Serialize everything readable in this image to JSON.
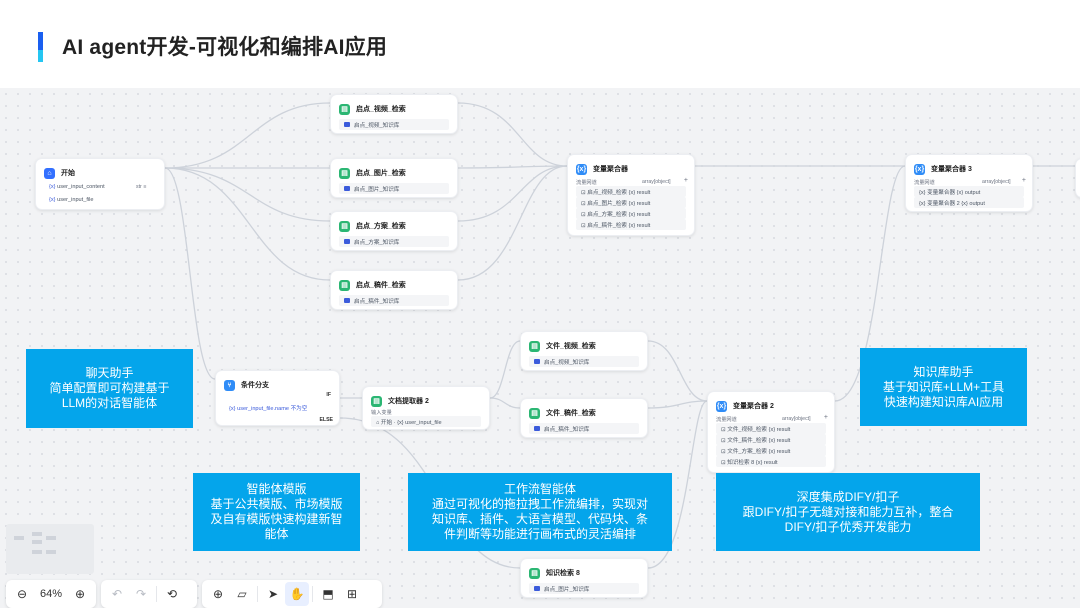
{
  "title": "AI agent开发-可视化和编排AI应用",
  "nodes": {
    "start": {
      "title": "开始",
      "var1": "user_input_content",
      "var1_tag": "str ≡",
      "var2": "user_input_file"
    },
    "video": {
      "title": "启点_视频_检索",
      "row": "启点_视频_知识库"
    },
    "image": {
      "title": "启点_图片_检索",
      "row": "启点_图片_知识库"
    },
    "plan": {
      "title": "启点_方案_检索",
      "row": "启点_方案_知识库"
    },
    "doc": {
      "title": "启点_稿件_检索",
      "row": "启点_稿件_知识库"
    },
    "agg1": {
      "title": "变量聚合器",
      "meta_left": "流量网道",
      "meta_right": "array[object]",
      "rows": [
        "⊡ 启点_视频_检索   {x} result",
        "⊡ 启点_图片_检索   {x} result",
        "⊡ 启点_方案_检索   {x} result",
        "⊡ 启点_稿件_检索   {x} result"
      ]
    },
    "agg3": {
      "title": "变量聚合器 3",
      "meta_left": "流量网道",
      "meta_right": "array[object]",
      "rows": [
        "{x} 变量聚合器   {x} output",
        "{x} 变量聚合器 2   {x} output"
      ]
    },
    "cond": {
      "title": "条件分支",
      "if": "IF",
      "cond_row": "{x} user_input_file.name 不为空",
      "else": "ELSE"
    },
    "extract": {
      "title": "文档提取器 2",
      "label": "输入变量",
      "row": "⌂ 开始 · {x} user_input_file"
    },
    "fvideo": {
      "title": "文件_视频_检索",
      "row": "启点_视频_知识库"
    },
    "fdoc": {
      "title": "文件_稿件_检索",
      "row": "启点_稿件_知识库"
    },
    "agg2": {
      "title": "变量聚合器 2",
      "meta_left": "流量网道",
      "meta_right": "array[object]",
      "rows": [
        "⊡ 文件_视频_检索   {x} result",
        "⊡ 文件_稿件_检索   {x} result",
        "⊡ 文件_方案_检索   {x} result",
        "⊡ 知识检索 8   {x} result"
      ]
    },
    "kb8": {
      "title": "知识检索 8",
      "row": "启点_图片_知识库"
    }
  },
  "annotations": {
    "chat": [
      "聊天助手",
      "简单配置即可构建基于",
      "LLM的对话智能体"
    ],
    "kb": [
      "知识库助手",
      "基于知识库+LLM+工具",
      "快速构建知识库AI应用"
    ],
    "template": [
      "智能体模版",
      "基于公共模版、市场模版",
      "及自有模版快速构建新智",
      "能体"
    ],
    "workflow": [
      "工作流智能体",
      "通过可视化的拖拉拽工作流编排，实现对",
      "知识库、插件、大语言模型、代码块、条",
      "件判断等功能进行画布式的灵活编排"
    ],
    "dify": [
      "深度集成DIFY/扣子",
      "跟DIFY/扣子无缝对接和能力互补，整合",
      "DIFY/扣子优秀开发能力"
    ]
  },
  "toolbar": {
    "zoom": "64%"
  },
  "colors": {
    "accent": "#04a5eb",
    "node_green": "#2bb673",
    "node_blue": "#3370ff",
    "edge": "#cdd2da"
  }
}
